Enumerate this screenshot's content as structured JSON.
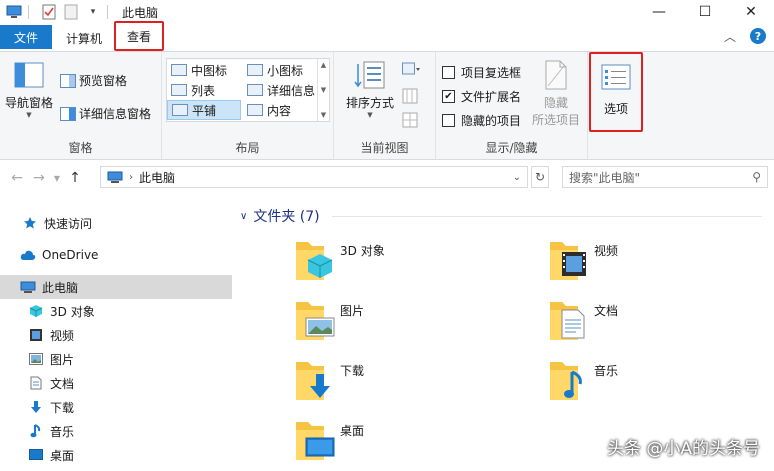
{
  "title_bar": {
    "title": "此电脑",
    "window_buttons": [
      "—",
      "☐",
      "✕"
    ]
  },
  "tabs": {
    "file": "文件",
    "computer": "计算机",
    "view": "查看"
  },
  "ribbon": {
    "pane": {
      "nav_pane": "导航窗格",
      "preview_pane": "预览窗格",
      "details_pane": "详细信息窗格",
      "label": "窗格"
    },
    "layout": {
      "items": [
        "中图标",
        "小图标",
        "列表",
        "详细信息",
        "平铺",
        "内容"
      ],
      "selected": "平铺",
      "label": "布局"
    },
    "current_view": {
      "sort_by": "排序方式",
      "label": "当前视图"
    },
    "show_hide": {
      "item_checkboxes": "项目复选框",
      "file_extensions": "文件扩展名",
      "hidden_items": "隐藏的项目",
      "hide_selected_1": "隐藏",
      "hide_selected_2": "所选项目",
      "label": "显示/隐藏",
      "item_checkboxes_checked": false,
      "file_extensions_checked": true,
      "hidden_items_checked": false
    },
    "options": {
      "label": "选项"
    }
  },
  "address": {
    "path": "此电脑",
    "search_placeholder": "搜索\"此电脑\""
  },
  "sidebar": {
    "items": [
      {
        "label": "快速访问",
        "icon": "star-icon"
      },
      {
        "label": "OneDrive",
        "icon": "cloud-icon"
      },
      {
        "label": "此电脑",
        "icon": "computer-icon",
        "selected": true
      },
      {
        "label": "3D 对象",
        "icon": "cube-icon"
      },
      {
        "label": "视频",
        "icon": "video-icon"
      },
      {
        "label": "图片",
        "icon": "picture-icon"
      },
      {
        "label": "文档",
        "icon": "document-icon"
      },
      {
        "label": "下载",
        "icon": "download-icon"
      },
      {
        "label": "音乐",
        "icon": "music-icon"
      },
      {
        "label": "桌面",
        "icon": "desktop-icon"
      }
    ]
  },
  "content": {
    "group_title": "文件夹 (7)",
    "folders": [
      {
        "name": "3D 对象",
        "icon": "cube-icon"
      },
      {
        "name": "视频",
        "icon": "video-icon"
      },
      {
        "name": "图片",
        "icon": "picture-icon"
      },
      {
        "name": "文档",
        "icon": "document-icon"
      },
      {
        "name": "下载",
        "icon": "download-icon"
      },
      {
        "name": "音乐",
        "icon": "music-icon"
      },
      {
        "name": "桌面",
        "icon": "desktop-icon"
      }
    ]
  },
  "watermark": "头条 @小A的头条号",
  "colors": {
    "accent": "#1979ca",
    "highlight_border": "#e02020",
    "folder": "#f6c343",
    "group_title": "#1e3287"
  }
}
